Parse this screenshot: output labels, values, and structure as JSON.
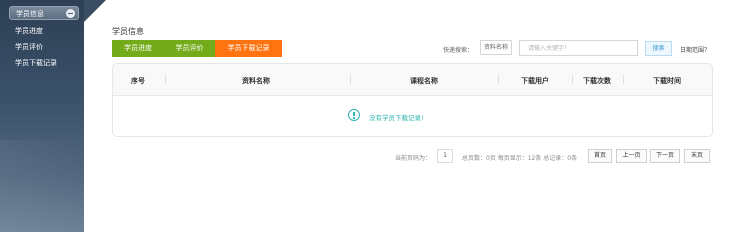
{
  "sidebar": {
    "header_label": "学员信息",
    "items": [
      {
        "label": "学员进度"
      },
      {
        "label": "学员评价"
      },
      {
        "label": "学员下载记录"
      }
    ]
  },
  "main": {
    "title": "学员信息",
    "tabs": [
      {
        "label": "学员进度",
        "color": "#73ab1a",
        "active": false
      },
      {
        "label": "学员评价",
        "color": "#73ab1a",
        "active": false
      },
      {
        "label": "学员下载记录",
        "color": "#ff7411",
        "active": true
      }
    ],
    "search": {
      "label": "快速搜索：",
      "field_selected": "资料名称",
      "placeholder": "请输入关键字！",
      "value": "",
      "button_label": "搜索",
      "help_label": "日期范围？"
    }
  },
  "table": {
    "columns": [
      "序号",
      "资料名称",
      "课程名称",
      "下载用户",
      "下载次数",
      "下载时间"
    ],
    "rows": [],
    "empty_message": "没有学员下载记录!"
  },
  "pagination": {
    "current_label": "当前页码为：",
    "current_page": "1",
    "summary": "总页数：0页 每页显示：12条 总记录：0条",
    "first_label": "首页",
    "prev_label": "上一页",
    "next_label": "下一页",
    "last_label": "末页"
  },
  "colors": {
    "tab_green": "#73ab1a",
    "tab_orange": "#ff7411",
    "empty_accent": "#2bb5ae",
    "search_button_text": "#3b9ad9"
  },
  "icons": {
    "collapse": "collapse-icon",
    "empty": "info-icon"
  }
}
